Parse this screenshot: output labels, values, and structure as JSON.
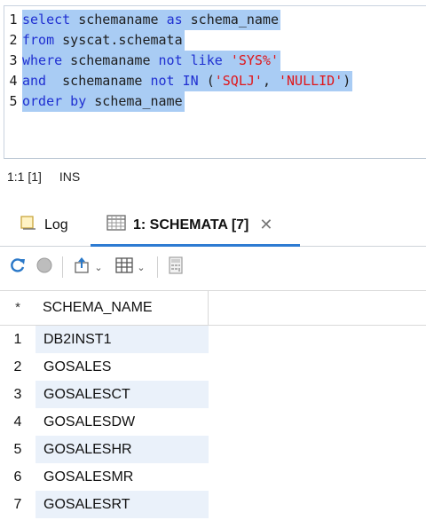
{
  "editor": {
    "lines": [
      {
        "num": "1",
        "tokens": [
          [
            "kw",
            "select"
          ],
          [
            "plain",
            " schemaname "
          ],
          [
            "kw",
            "as"
          ],
          [
            "plain",
            " schema_name"
          ]
        ]
      },
      {
        "num": "2",
        "tokens": [
          [
            "kw",
            "from"
          ],
          [
            "plain",
            " syscat.schemata"
          ]
        ]
      },
      {
        "num": "3",
        "tokens": [
          [
            "kw",
            "where"
          ],
          [
            "plain",
            " schemaname "
          ],
          [
            "kw",
            "not like"
          ],
          [
            "plain",
            " "
          ],
          [
            "str",
            "'SYS%'"
          ]
        ]
      },
      {
        "num": "4",
        "tokens": [
          [
            "kw",
            "and"
          ],
          [
            "plain",
            "  schemaname "
          ],
          [
            "kw",
            "not IN"
          ],
          [
            "plain",
            " ("
          ],
          [
            "str",
            "'SQLJ'"
          ],
          [
            "plain",
            ", "
          ],
          [
            "str",
            "'NULLID'"
          ],
          [
            "plain",
            ")"
          ]
        ]
      },
      {
        "num": "5",
        "tokens": [
          [
            "kw",
            "order by"
          ],
          [
            "plain",
            " schema_name"
          ]
        ]
      }
    ],
    "colors": {
      "keyword": "#1f2fd1",
      "string": "#e0161a",
      "selection": "#a9ccf4"
    }
  },
  "status": {
    "position": "1:1 [1]",
    "mode": "INS"
  },
  "tabs": {
    "log_label": "Log",
    "result_label": "1: SCHEMATA [7]",
    "close_glyph": "✕",
    "active_accent": "#2d7bd2"
  },
  "toolbar": {
    "icons": [
      "refresh-icon",
      "stop-icon",
      "export-icon",
      "grid-view-icon",
      "calculator-icon"
    ]
  },
  "grid": {
    "star": "*",
    "column_header": "SCHEMA_NAME",
    "rows": [
      {
        "num": "1",
        "value": "DB2INST1"
      },
      {
        "num": "2",
        "value": "GOSALES"
      },
      {
        "num": "3",
        "value": "GOSALESCT"
      },
      {
        "num": "4",
        "value": "GOSALESDW"
      },
      {
        "num": "5",
        "value": "GOSALESHR"
      },
      {
        "num": "6",
        "value": "GOSALESMR"
      },
      {
        "num": "7",
        "value": "GOSALESRT"
      }
    ]
  }
}
